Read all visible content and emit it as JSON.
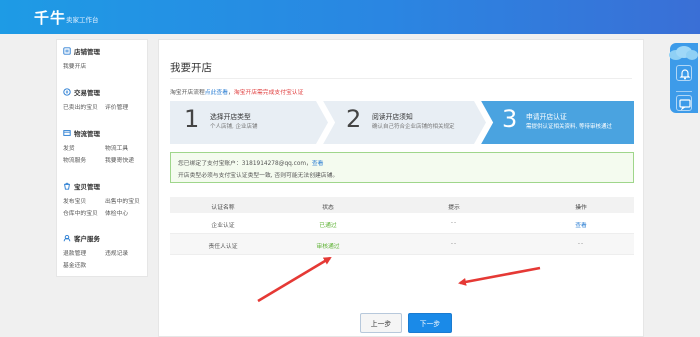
{
  "header": {
    "logo": "千牛",
    "subtitle": "卖家工作台"
  },
  "sidebar": {
    "groups": [
      {
        "title": "店铺管理",
        "icon": "store-icon",
        "items": [
          "我要开店"
        ]
      },
      {
        "title": "交易管理",
        "icon": "trade-icon",
        "items": [
          "已卖出的宝贝",
          "评价管理"
        ]
      },
      {
        "title": "物流管理",
        "icon": "logistics-icon",
        "items": [
          "发货",
          "物流工具",
          "物流服务",
          "我要寄快递"
        ]
      },
      {
        "title": "宝贝管理",
        "icon": "goods-icon",
        "items": [
          "发布宝贝",
          "出售中的宝贝",
          "仓库中的宝贝",
          "体检中心"
        ]
      },
      {
        "title": "客户服务",
        "icon": "customer-service-icon",
        "items": [
          "退款管理",
          "违规记录",
          "基金还款"
        ]
      }
    ]
  },
  "main": {
    "page_title": "我要开店",
    "flow_note": {
      "prefix": "淘宝开店流程",
      "link": "点此查看",
      "sep": "，",
      "red": "淘宝开店需完成支付宝认证"
    },
    "steps": [
      {
        "num": "1",
        "title": "选择开店类型",
        "desc": "个人店铺, 企业店铺"
      },
      {
        "num": "2",
        "title": "阅读开店须知",
        "desc": "确认自己符合企业店铺的相关规定"
      },
      {
        "num": "3",
        "title": "申请开店认证",
        "desc": "需提供认证相关资料, 等待审核通过"
      }
    ],
    "alert": {
      "line1_prefix": "您已绑定了支付宝账户：3181914278@qq.com，",
      "line1_link": "查看",
      "line2": "开店类型必须与支付宝认证类型一致, 否则可能无法创建店铺。"
    },
    "table": {
      "headers": [
        "认证名称",
        "状态",
        "提示",
        "操作"
      ],
      "rows": [
        {
          "name": "企业认证",
          "status": "已通过",
          "hint": "--",
          "action": "查看"
        },
        {
          "name": "责任人认证",
          "status": "审核通过",
          "hint": "--",
          "action": "--"
        }
      ]
    },
    "buttons": {
      "prev": "上一步",
      "next": "下一步"
    }
  },
  "colors": {
    "accent": "#1a8ae8",
    "step_active": "#4aa3e0",
    "step_inactive": "#e8eef4",
    "success": "#5fb336",
    "arrow": "#e53935"
  }
}
